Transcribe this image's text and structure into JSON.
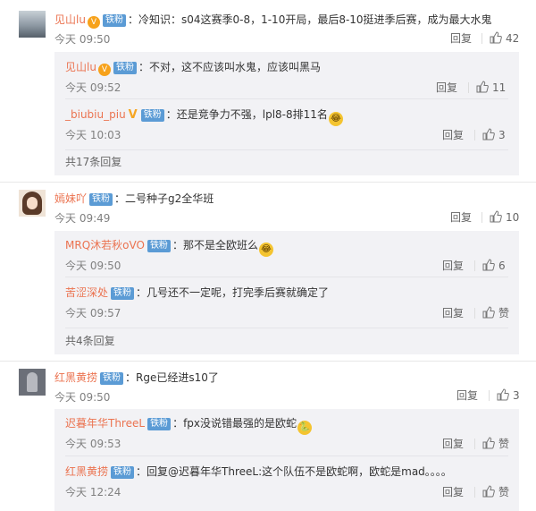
{
  "common": {
    "reply_label": "回复",
    "colon": "："
  },
  "comments": [
    {
      "user": "见山lu",
      "badge": "铁粉",
      "vip": "V",
      "text": "冷知识：s04这赛季0-8，1-10开局，最后8-10挺进季后赛，成为最大水鬼",
      "time": "今天 09:50",
      "likes": "42",
      "replies": [
        {
          "user": "见山lu",
          "badge": "铁粉",
          "vip": "V",
          "text": "不对，这不应该叫水鬼，应该叫黑马",
          "time": "今天 09:52",
          "likes": "11"
        },
        {
          "user": "_biubiu_piu",
          "verified": "V",
          "badge": "铁粉",
          "text": "还是竞争力不强，lpl8-8排11名",
          "emoji": "😂",
          "time": "今天 10:03",
          "likes": "3"
        }
      ],
      "more": "共17条回复"
    },
    {
      "user": "嫣妹吖",
      "badge": "铁粉",
      "text": "二号种子g2全华班",
      "time": "今天 09:49",
      "likes": "10",
      "replies": [
        {
          "user": "MRQ沐若秋oVO",
          "badge": "铁粉",
          "text": "那不是全欧班么",
          "emoji": "😂",
          "time": "今天 09:50",
          "likes": "6"
        },
        {
          "user": "苦涩深处",
          "badge": "铁粉",
          "text": "几号还不一定呢，打完季后赛就确定了",
          "time": "今天 09:57",
          "likes": "赞"
        }
      ],
      "more": "共4条回复"
    },
    {
      "user": "红黑黄捞",
      "badge": "铁粉",
      "text": "Rge已经进s10了",
      "time": "今天 09:50",
      "likes": "3",
      "replies": [
        {
          "user": "迟暮年华ThreeL",
          "badge": "铁粉",
          "text": "fpx没说错最强的是欧蛇",
          "emoji": "🐍",
          "time": "今天 09:53",
          "likes": "赞"
        },
        {
          "user": "红黑黄捞",
          "badge": "铁粉",
          "text": "回复@迟暮年华ThreeL:这个队伍不是欧蛇啊，欧蛇是mad。。。。",
          "time": "今天 12:24",
          "likes": "赞"
        }
      ]
    }
  ]
}
